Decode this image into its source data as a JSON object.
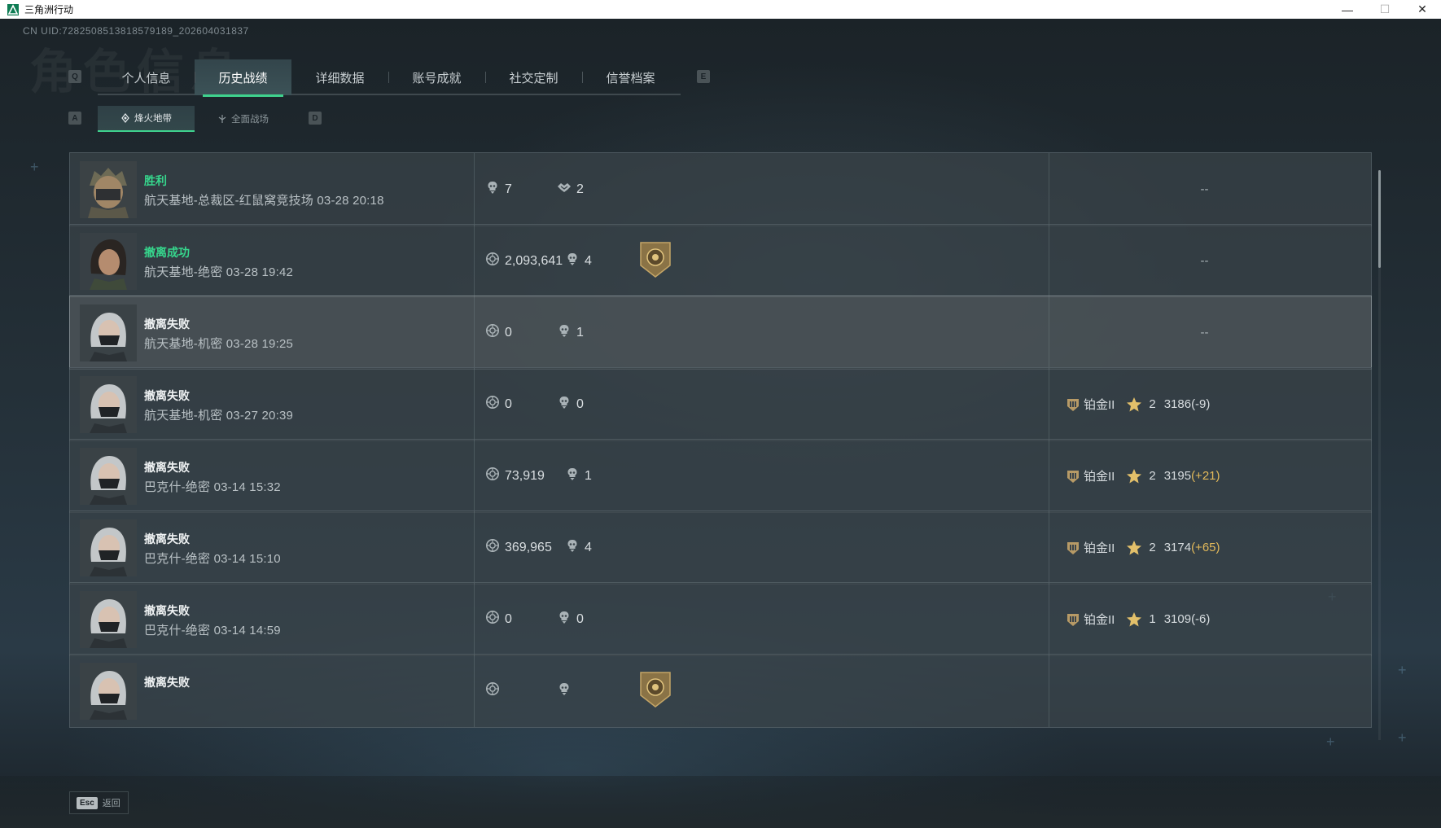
{
  "window": {
    "title": "三角洲行动"
  },
  "uid": "CN UID:7282508513818579189_202604031837",
  "tabs": {
    "left_key": "Q",
    "right_key": "E",
    "items": [
      {
        "label": "个人信息",
        "active": false
      },
      {
        "label": "历史战绩",
        "active": true
      },
      {
        "label": "详细数据",
        "active": false
      },
      {
        "label": "账号成就",
        "active": false
      },
      {
        "label": "社交定制",
        "active": false
      },
      {
        "label": "信誉档案",
        "active": false
      }
    ]
  },
  "subtabs": {
    "left_key": "A",
    "right_key": "D",
    "items": [
      {
        "label": "烽火地带",
        "active": true
      },
      {
        "label": "全面战场",
        "active": false
      }
    ]
  },
  "matches": [
    {
      "result": "胜利",
      "result_green": true,
      "detail": "航天基地-总裁区-红鼠窝竞技场 03-28 20:18",
      "stat1_icon": "kill-icon",
      "stat1": "7",
      "stat2_icon": "assist-icon",
      "stat2": "2",
      "badge": false,
      "right": "--",
      "avatar": "helmet"
    },
    {
      "result": "撤离成功",
      "result_green": true,
      "detail": "航天基地-绝密 03-28 19:42",
      "stat1_icon": "coin-icon",
      "stat1": "2,093,641",
      "stat2_icon": "kill-icon",
      "stat2": "4",
      "badge": true,
      "right": "--",
      "avatar": "woman"
    },
    {
      "result": "撤离失败",
      "result_green": false,
      "detail": "航天基地-机密 03-28 19:25",
      "stat1_icon": "coin-icon",
      "stat1": "0",
      "stat2_icon": "kill-icon",
      "stat2": "1",
      "badge": false,
      "right": "--",
      "avatar": "masked",
      "highlight": true
    },
    {
      "result": "撤离失败",
      "result_green": false,
      "detail": "航天基地-机密 03-27 20:39",
      "stat1_icon": "coin-icon",
      "stat1": "0",
      "stat2_icon": "kill-icon",
      "stat2": "0",
      "badge": false,
      "rank": {
        "name": "铂金II",
        "stars": "2",
        "score": "3186",
        "delta": "(-9)",
        "positive": false
      },
      "avatar": "masked"
    },
    {
      "result": "撤离失败",
      "result_green": false,
      "detail": "巴克什-绝密 03-14 15:32",
      "stat1_icon": "coin-icon",
      "stat1": "73,919",
      "stat2_icon": "kill-icon",
      "stat2": "1",
      "badge": false,
      "rank": {
        "name": "铂金II",
        "stars": "2",
        "score": "3195",
        "delta": "(+21)",
        "positive": true
      },
      "avatar": "masked"
    },
    {
      "result": "撤离失败",
      "result_green": false,
      "detail": "巴克什-绝密 03-14 15:10",
      "stat1_icon": "coin-icon",
      "stat1": "369,965",
      "stat2_icon": "kill-icon",
      "stat2": "4",
      "badge": false,
      "rank": {
        "name": "铂金II",
        "stars": "2",
        "score": "3174",
        "delta": "(+65)",
        "positive": true
      },
      "avatar": "masked"
    },
    {
      "result": "撤离失败",
      "result_green": false,
      "detail": "巴克什-绝密 03-14 14:59",
      "stat1_icon": "coin-icon",
      "stat1": "0",
      "stat2_icon": "kill-icon",
      "stat2": "0",
      "badge": false,
      "rank": {
        "name": "铂金II",
        "stars": "1",
        "score": "3109",
        "delta": "(-6)",
        "positive": false
      },
      "avatar": "masked"
    },
    {
      "result": "撤离失败",
      "result_green": false,
      "detail": "",
      "stat1_icon": "coin-icon",
      "stat1": "",
      "stat2_icon": "kill-icon",
      "stat2": "",
      "badge": true,
      "avatar": "masked",
      "partial": true
    }
  ],
  "footer": {
    "esc_key": "Esc",
    "back_label": "返回"
  },
  "colors": {
    "accent_green": "#3fd28e",
    "result_green": "#36d78d",
    "delta_positive": "#e2b95a"
  }
}
